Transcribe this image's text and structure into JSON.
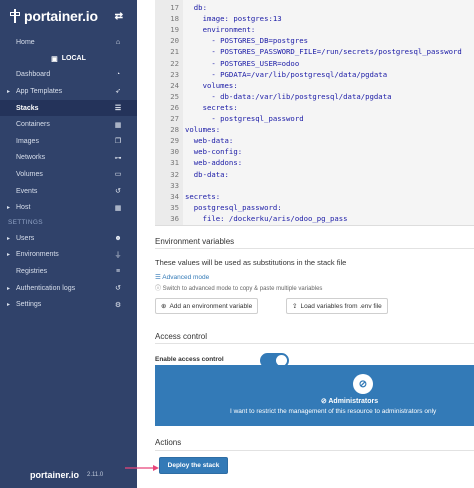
{
  "sidebar": {
    "brand": "portainer.io",
    "home": "Home",
    "endpoint": "LOCAL",
    "items": [
      {
        "label": "Dashboard",
        "icon": "tachometer-icon"
      },
      {
        "label": "App Templates",
        "icon": "rocket-icon"
      },
      {
        "label": "Stacks",
        "icon": "th-list-icon"
      },
      {
        "label": "Containers",
        "icon": "cubes-icon"
      },
      {
        "label": "Images",
        "icon": "clone-icon"
      },
      {
        "label": "Networks",
        "icon": "sitemap-icon"
      },
      {
        "label": "Volumes",
        "icon": "hdd-icon"
      },
      {
        "label": "Events",
        "icon": "history-icon"
      },
      {
        "label": "Host",
        "icon": "th-icon"
      }
    ],
    "settings_heading": "SETTINGS",
    "settings_items": [
      {
        "label": "Users",
        "icon": "users-icon"
      },
      {
        "label": "Environments",
        "icon": "plug-icon"
      },
      {
        "label": "Registries",
        "icon": "database-icon"
      },
      {
        "label": "Authentication logs",
        "icon": "history-icon"
      },
      {
        "label": "Settings",
        "icon": "cogs-icon"
      }
    ],
    "footer_logo": "portainer.io",
    "version": "2.11.0"
  },
  "editor": {
    "lines": [
      {
        "n": "17",
        "t": "  db:"
      },
      {
        "n": "18",
        "t": "    image: postgres:13"
      },
      {
        "n": "19",
        "t": "    environment:"
      },
      {
        "n": "20",
        "t": "      - POSTGRES_DB=postgres"
      },
      {
        "n": "21",
        "t": "      - POSTGRES_PASSWORD_FILE=/run/secrets/postgresql_password"
      },
      {
        "n": "22",
        "t": "      - POSTGRES_USER=odoo"
      },
      {
        "n": "23",
        "t": "      - PGDATA=/var/lib/postgresql/data/pgdata"
      },
      {
        "n": "24",
        "t": "    volumes:"
      },
      {
        "n": "25",
        "t": "      - db-data:/var/lib/postgresql/data/pgdata"
      },
      {
        "n": "26",
        "t": "    secrets:"
      },
      {
        "n": "27",
        "t": "      - postgresql_password"
      },
      {
        "n": "28",
        "t": "volumes:"
      },
      {
        "n": "29",
        "t": "  web-data:"
      },
      {
        "n": "30",
        "t": "  web-config:"
      },
      {
        "n": "31",
        "t": "  web-addons:"
      },
      {
        "n": "32",
        "t": "  db-data:"
      },
      {
        "n": "33",
        "t": ""
      },
      {
        "n": "34",
        "t": "secrets:"
      },
      {
        "n": "35",
        "t": "  postgresql_password:"
      },
      {
        "n": "36",
        "t": "    file: /dockerku/aris/odoo_pg_pass"
      }
    ]
  },
  "env": {
    "title": "Environment variables",
    "info": "These values will be used as substitutions in the stack file",
    "advanced": "Advanced mode",
    "hint": "Switch to advanced mode to copy & paste multiple variables",
    "add_btn": "Add an environment variable",
    "load_btn": "Load variables from .env file"
  },
  "access": {
    "title": "Access control",
    "toggle_label": "Enable access control",
    "enabled": true,
    "admin_title": "Administrators",
    "admin_desc": "I want to restrict the management of this resource to administrators only"
  },
  "actions": {
    "title": "Actions",
    "deploy": "Deploy the stack"
  },
  "colors": {
    "sidebar": "#30426a",
    "accent": "#337ab7",
    "arrow": "#e8457a"
  }
}
